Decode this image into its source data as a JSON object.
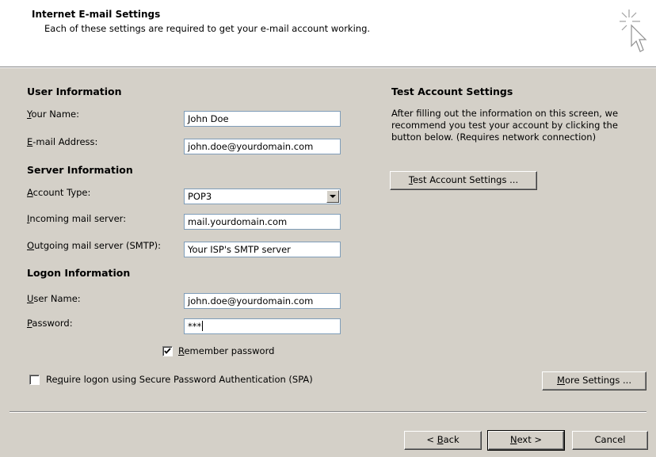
{
  "header": {
    "title": "Internet E-mail Settings",
    "subtitle": "Each of these settings are required to get your e-mail account working.",
    "icon": "cursor-sparkle-icon"
  },
  "user_info": {
    "heading": "User Information",
    "your_name_label": "Your Name:",
    "your_name_value": "John Doe",
    "email_label": "E-mail Address:",
    "email_value": "john.doe@yourdomain.com"
  },
  "server_info": {
    "heading": "Server Information",
    "account_type_label": "Account Type:",
    "account_type_value": "POP3",
    "incoming_label": "Incoming mail server:",
    "incoming_value": "mail.yourdomain.com",
    "outgoing_label": "Outgoing mail server (SMTP):",
    "outgoing_value": "Your ISP's SMTP server"
  },
  "logon_info": {
    "heading": "Logon Information",
    "username_label": "User Name:",
    "username_value": "john.doe@yourdomain.com",
    "password_label": "Password:",
    "password_value": "***",
    "remember_label": "Remember password",
    "remember_checked": true,
    "spa_label": "Require logon using Secure Password Authentication (SPA)",
    "spa_checked": false
  },
  "test_settings": {
    "heading": "Test Account Settings",
    "description": [
      "After filling out the information on this screen, we",
      "recommend you test your account by clicking the",
      "button below. (Requires network connection)"
    ],
    "test_button": "Test Account Settings ..."
  },
  "buttons": {
    "more_settings": "More Settings ...",
    "back": "< Back",
    "next": "Next >",
    "cancel": "Cancel"
  }
}
